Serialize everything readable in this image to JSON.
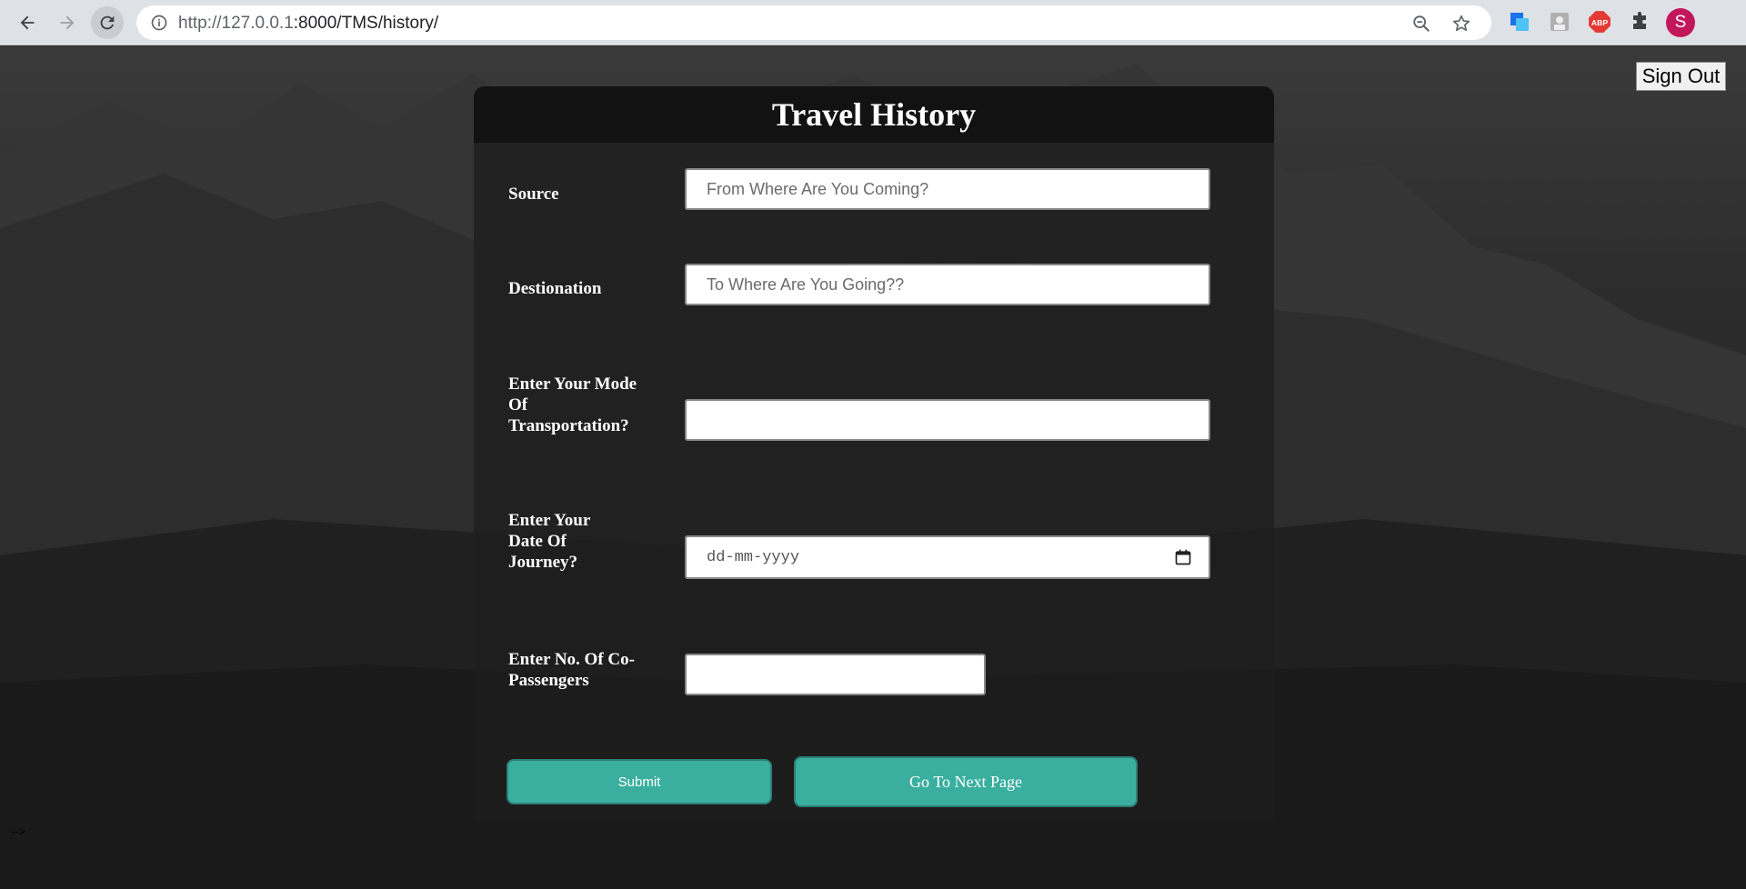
{
  "browser": {
    "url_host": "http://127.0.0.1",
    "url_rest": ":8000/TMS/history/",
    "profile_initial": "S"
  },
  "page": {
    "title": "Travel History",
    "signout_label": "Sign Out",
    "fields": {
      "source": {
        "label": "Source",
        "placeholder": "From Where Are You Coming?"
      },
      "destination": {
        "label": "Destionation",
        "placeholder": "To Where Are You Going??"
      },
      "transport": {
        "label": "Enter Your Mode Of Transportation?",
        "placeholder": ""
      },
      "date": {
        "label": "Enter Your Date Of Journey?",
        "placeholder": "dd-mm-yyyy"
      },
      "passengers": {
        "label": "Enter No. Of Co-Passengers",
        "placeholder": ""
      }
    },
    "submit_label": "Submit",
    "next_label": "Go To Next Page",
    "stray_text": "-->"
  },
  "colors": {
    "accent": "#3aaf9f",
    "avatar": "#c2185b"
  }
}
